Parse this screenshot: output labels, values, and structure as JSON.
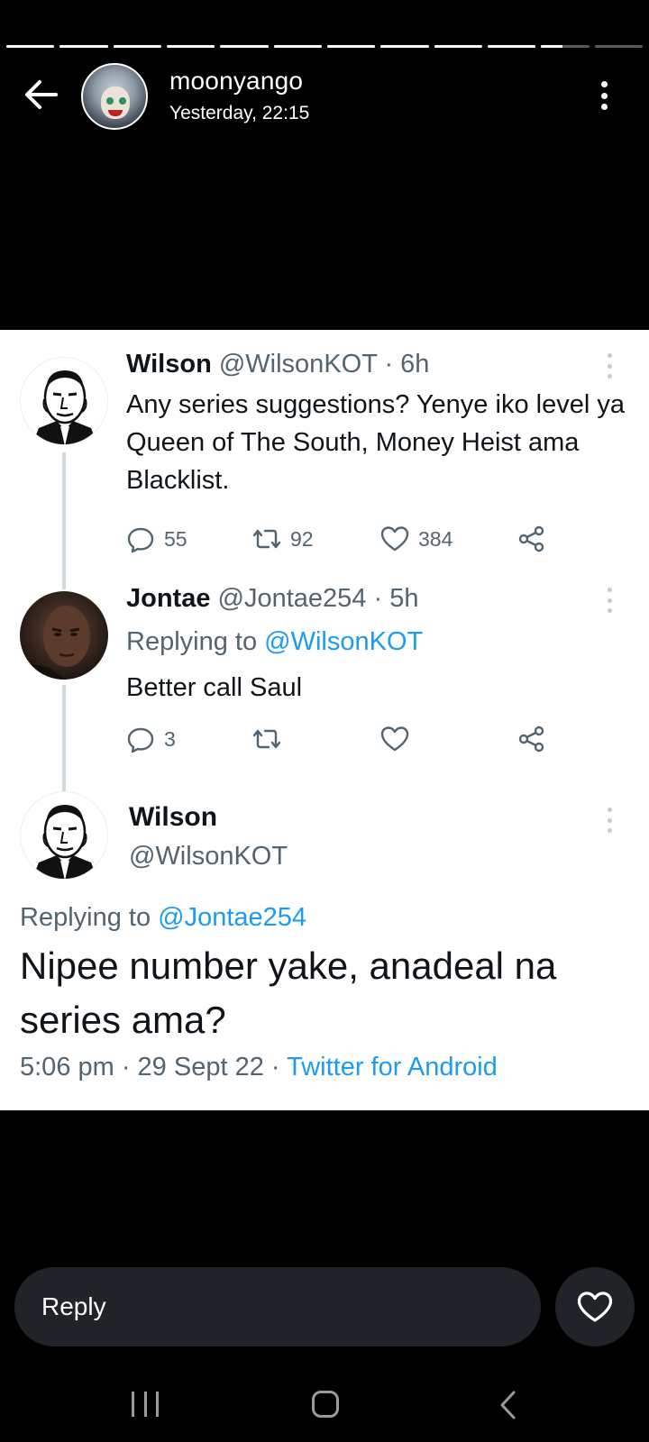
{
  "story": {
    "progress": {
      "segments_total": 12,
      "segments_complete": 10,
      "current_segment_fraction": 0.45
    },
    "username": "moonyango",
    "timestamp": "Yesterday, 22:15"
  },
  "tweets": [
    {
      "name": "Wilson",
      "handle_time": "@WilsonKOT · 6h",
      "text": "Any series suggestions? Yenye iko level ya Queen of The South, Money Heist ama Blacklist.",
      "replies": "55",
      "retweets": "92",
      "likes": "384"
    },
    {
      "name": "Jontae",
      "handle_time": "@Jontae254 · 5h",
      "replying_prefix": "Replying to",
      "replying_handle": "@WilsonKOT",
      "text": "Better call Saul",
      "replies": "3"
    }
  ],
  "focused_tweet": {
    "name": "Wilson",
    "handle": "@WilsonKOT",
    "replying_prefix": "Replying to",
    "replying_handle": "@Jontae254",
    "text": "Nipee number yake, anadeal na series ama?",
    "date_meta": "5:06 pm · 29 Sept 22 · ",
    "source": "Twitter for Android"
  },
  "reply_bar": {
    "placeholder": "Reply"
  },
  "colors": {
    "link": "#1d9bf0",
    "meta": "#536471",
    "reply_bg": "#202327"
  }
}
